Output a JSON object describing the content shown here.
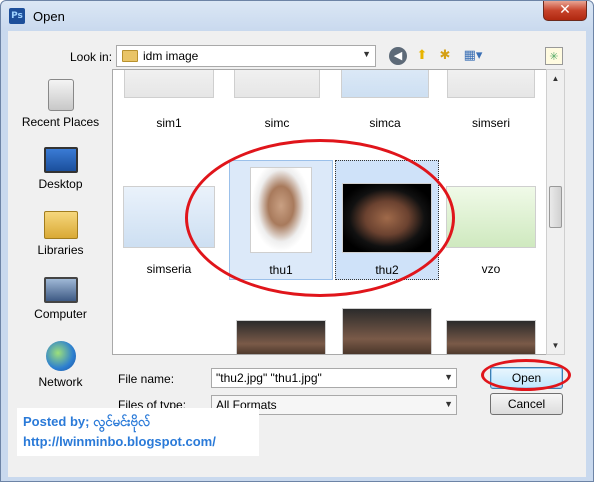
{
  "window": {
    "title": "Open",
    "app_icon_text": "Ps",
    "close_glyph": "✕"
  },
  "toolbar": {
    "lookin_label": "Look in:",
    "lookin_value": "idm image",
    "icons": [
      "back-icon",
      "up-folder-icon",
      "new-folder-icon",
      "view-menu-icon",
      "extra-icon"
    ]
  },
  "places": [
    {
      "label": "Recent Places",
      "icon": "recent-places-icon"
    },
    {
      "label": "Desktop",
      "icon": "desktop-icon"
    },
    {
      "label": "Libraries",
      "icon": "libraries-icon"
    },
    {
      "label": "Computer",
      "icon": "computer-icon"
    },
    {
      "label": "Network",
      "icon": "network-icon"
    }
  ],
  "files": {
    "row1": [
      {
        "label": "sim1"
      },
      {
        "label": "simc"
      },
      {
        "label": "simca"
      },
      {
        "label": "simseri"
      }
    ],
    "row2": [
      {
        "label": "simseria"
      },
      {
        "label": "thu1",
        "selected": true
      },
      {
        "label": "thu2",
        "selected": true,
        "focused": true
      },
      {
        "label": "vzo"
      }
    ],
    "row3": [
      {
        "label": ""
      },
      {
        "label": ""
      },
      {
        "label": ""
      }
    ]
  },
  "form": {
    "filename_label": "File name:",
    "filename_value": "\"thu2.jpg\" \"thu1.jpg\"",
    "filetype_label": "Files of type:",
    "filetype_value": "All Formats",
    "open_label": "Open",
    "cancel_label": "Cancel"
  },
  "credit": {
    "line1": "Posted by; လွင်မင်းဗိုလ်",
    "line2": "http://lwinminbo.blogspot.com/"
  },
  "colors": {
    "annotation": "#e0151b",
    "credit_text": "#2a7ad8",
    "selection": "#dce9f9"
  }
}
